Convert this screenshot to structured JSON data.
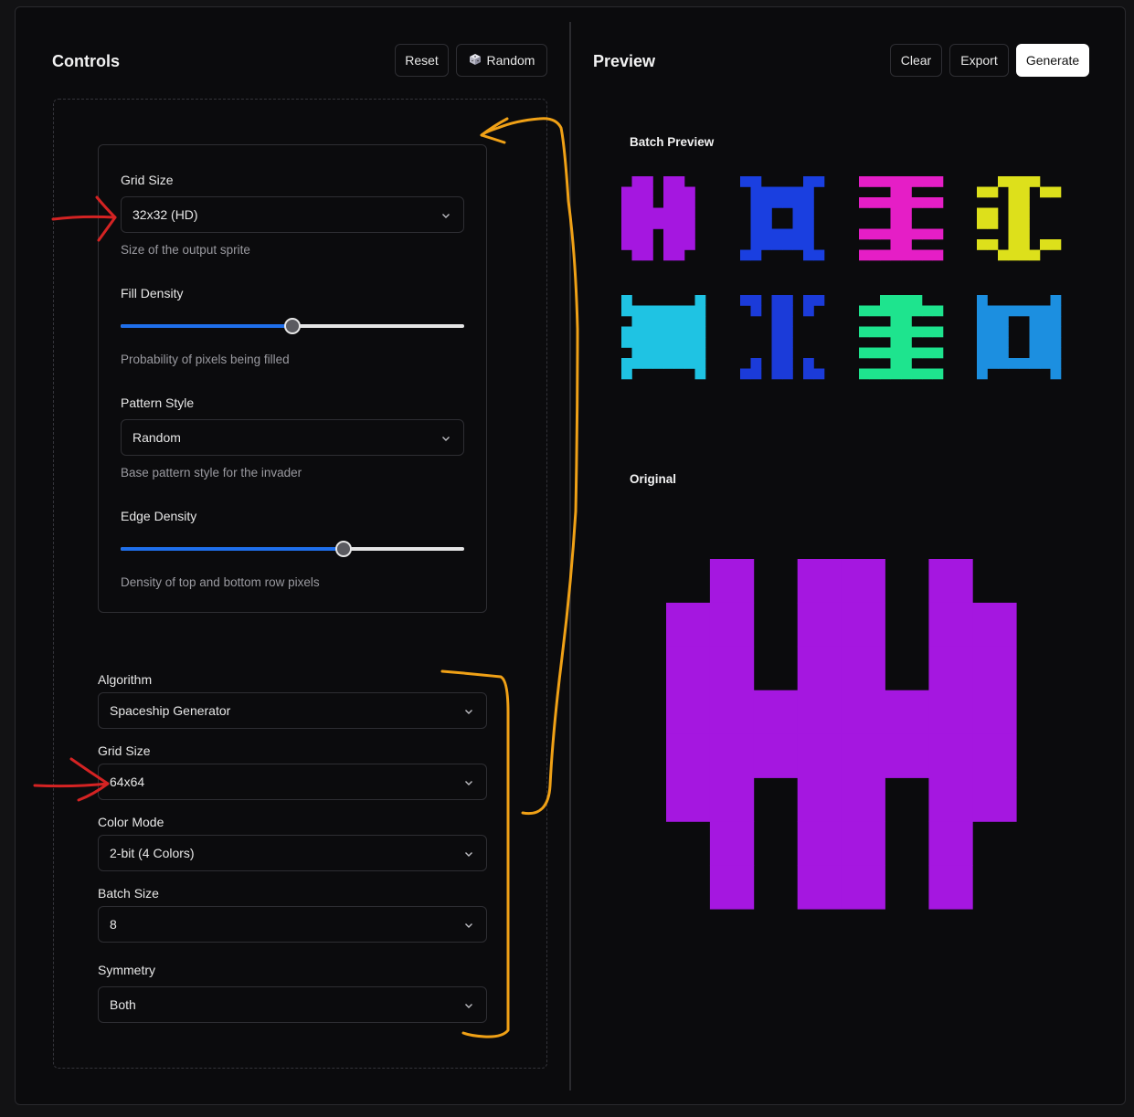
{
  "controls": {
    "title": "Controls",
    "reset_label": "Reset",
    "random_label": "Random",
    "grid_size": {
      "label": "Grid Size",
      "value": "32x32 (HD)",
      "hint": "Size of the output sprite"
    },
    "fill_density": {
      "label": "Fill Density",
      "hint": "Probability of pixels being filled",
      "value": 0.5
    },
    "pattern_style": {
      "label": "Pattern Style",
      "value": "Random",
      "hint": "Base pattern style for the invader"
    },
    "edge_density": {
      "label": "Edge Density",
      "hint": "Density of top and bottom row pixels",
      "value": 0.65
    },
    "algorithm": {
      "label": "Algorithm",
      "value": "Spaceship Generator"
    },
    "grid_size2": {
      "label": "Grid Size",
      "value": "64x64"
    },
    "color_mode": {
      "label": "Color Mode",
      "value": "2-bit (4 Colors)"
    },
    "batch_size": {
      "label": "Batch Size",
      "value": "8"
    },
    "symmetry": {
      "label": "Symmetry",
      "value": "Both"
    }
  },
  "preview": {
    "title": "Preview",
    "clear_label": "Clear",
    "export_label": "Export",
    "generate_label": "Generate",
    "batch_title": "Batch Preview",
    "original_title": "Original",
    "batch_colors": [
      "#a517e0",
      "#1a3fe0",
      "#e51ec6",
      "#dde01b",
      "#1fc3e3",
      "#1b3bd9",
      "#1ee48e",
      "#1c8fe0"
    ],
    "original_color": "#a517e0"
  },
  "icons": {
    "random": "dice-icon",
    "select": "chevron-down-icon"
  }
}
